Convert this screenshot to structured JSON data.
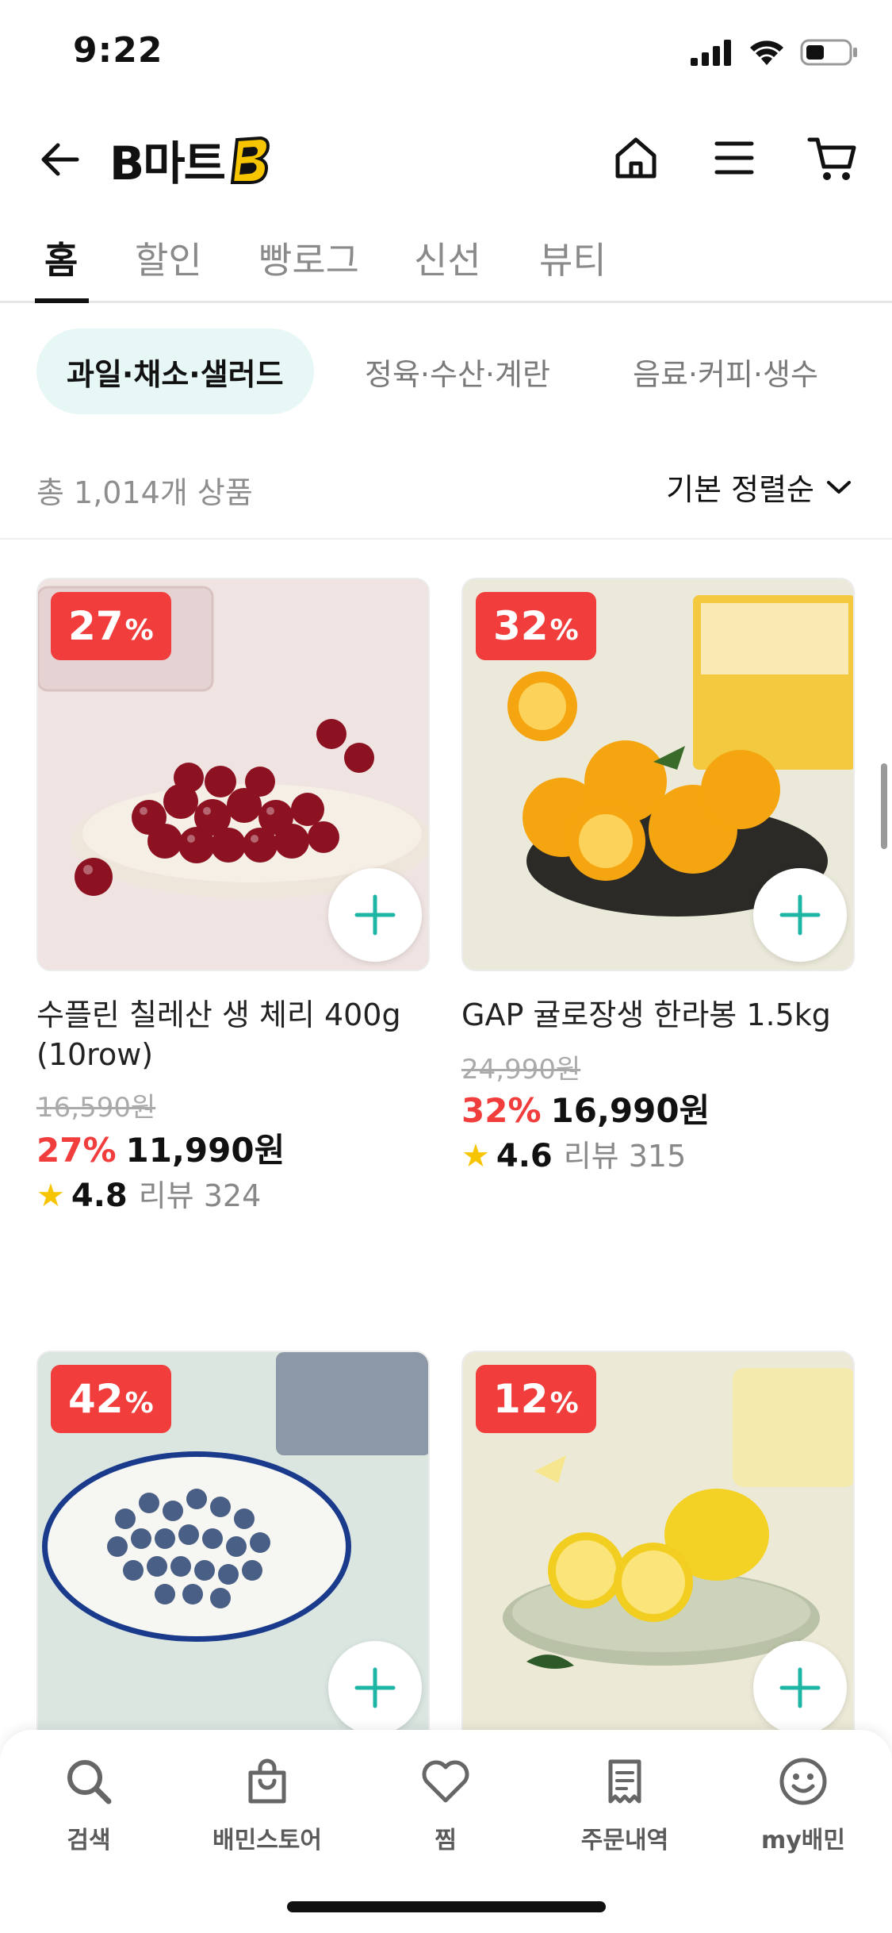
{
  "status": {
    "time": "9:22"
  },
  "header": {
    "logo_text": "B마트",
    "icons": [
      "back-arrow-icon",
      "home-icon",
      "menu-icon",
      "cart-icon"
    ]
  },
  "tabs": [
    {
      "label": "홈",
      "active": true
    },
    {
      "label": "할인",
      "active": false
    },
    {
      "label": "빵로그",
      "active": false
    },
    {
      "label": "신선",
      "active": false
    },
    {
      "label": "뷰티",
      "active": false
    }
  ],
  "chips": [
    {
      "label": "과일·채소·샐러드",
      "active": true
    },
    {
      "label": "정육·수산·계란",
      "active": false
    },
    {
      "label": "음료·커피·생수",
      "active": false
    }
  ],
  "listing": {
    "count_label": "총 1,014개 상품",
    "sort_label": "기본 정렬순"
  },
  "products": [
    {
      "discount_num": "27",
      "discount_pct": "%",
      "name": "수플린 칠레산 생 체리 400g (10row)",
      "original_price": "16,590원",
      "rate": "27%",
      "price": "11,990원",
      "rating": "4.8",
      "reviews": "리뷰 324"
    },
    {
      "discount_num": "32",
      "discount_pct": "%",
      "name": "GAP 귤로장생 한라봉 1.5kg",
      "original_price": "24,990원",
      "rate": "32%",
      "price": "16,990원",
      "rating": "4.6",
      "reviews": "리뷰 315"
    },
    {
      "discount_num": "42",
      "discount_pct": "%"
    },
    {
      "discount_num": "12",
      "discount_pct": "%"
    }
  ],
  "bottom_nav": [
    {
      "label": "검색"
    },
    {
      "label": "배민스토어"
    },
    {
      "label": "찜"
    },
    {
      "label": "주문내역"
    },
    {
      "label": "my배민"
    }
  ],
  "colors": {
    "accent_teal": "#1fb5a5",
    "discount_red": "#f23d3d",
    "chip_bg": "#e6f7f6",
    "star": "#f7c500"
  }
}
